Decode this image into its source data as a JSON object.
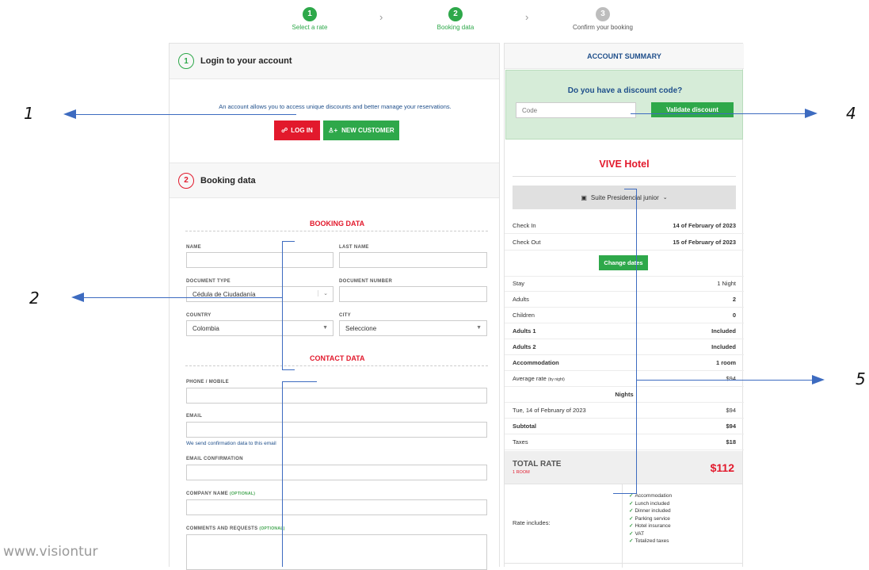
{
  "steps": [
    {
      "num": "1",
      "label": "Select a rate"
    },
    {
      "num": "2",
      "label": "Booking data"
    },
    {
      "num": "3",
      "label": "Confirm your booking"
    }
  ],
  "login": {
    "num": "1",
    "title": "Login to your account",
    "info": "An account allows you to access unique discounts and better manage your reservations.",
    "login_button": "LOG IN",
    "new_customer_button": "NEW CUSTOMER"
  },
  "booking": {
    "num": "2",
    "title": "Booking data",
    "booking_heading": "BOOKING DATA",
    "contact_heading": "CONTACT DATA",
    "name_label": "NAME",
    "lastname_label": "LAST NAME",
    "doctype_label": "DOCUMENT TYPE",
    "doctype_value": "Cédula de Ciudadanía",
    "docnum_label": "DOCUMENT NUMBER",
    "country_label": "COUNTRY",
    "country_value": "Colombia",
    "city_label": "CITY",
    "city_value": "Seleccione",
    "phone_label": "PHONE / MOBILE",
    "email_label": "EMAIL",
    "email_note": "We send confirmation data to this email",
    "email_confirm_label": "EMAIL CONFIRMATION",
    "company_label": "COMPANY NAME",
    "company_optional": "(OPTIONAL)",
    "comments_label": "COMMENTS AND REQUESTS",
    "comments_optional": "(OPTIONAL)"
  },
  "summary": {
    "title": "ACCOUNT SUMMARY",
    "discount_title": "Do you have a discount code?",
    "code_placeholder": "Code",
    "validate_button": "Validate discount",
    "hotel": "VIVE Hotel",
    "room": "Suite Presidencial junior",
    "checkin_label": "Check In",
    "checkin_value": "14 of February of 2023",
    "checkout_label": "Check Out",
    "checkout_value": "15 of February of 2023",
    "change_dates_button": "Change dates",
    "rows": [
      {
        "label": "Stay",
        "value": "1 Night",
        "bold": false
      },
      {
        "label": "Adults",
        "value": "2",
        "bold": false
      },
      {
        "label": "Children",
        "value": "0",
        "bold": false
      },
      {
        "label": "Adults 1",
        "value": "Included",
        "bold": true
      },
      {
        "label": "Adults 2",
        "value": "Included",
        "bold": true
      },
      {
        "label": "Accommodation",
        "value": "1 room",
        "bold": true
      }
    ],
    "avg_rate_label": "Average rate",
    "avg_rate_note": "(by night)",
    "avg_rate_value": "$94",
    "nights_heading": "Nights",
    "night_rows": [
      {
        "label": "Tue, 14 of February of 2023",
        "value": "$94",
        "bold": false
      },
      {
        "label": "Subtotal",
        "value": "$94",
        "bold": true
      },
      {
        "label": "Taxes",
        "value": "$18",
        "bold": true
      }
    ],
    "total_label": "TOTAL RATE",
    "total_rooms": "1 ROOM",
    "total_value": "$112",
    "includes_label": "Rate includes:",
    "includes": [
      "Accommodation",
      "Lunch included",
      "Dinner included",
      "Parking service",
      "Hotel insurance",
      "VAT",
      "Totalized taxes"
    ]
  },
  "callouts": [
    "1",
    "2",
    "4",
    "5"
  ],
  "watermark": "www.visiontur",
  "colors": {
    "green": "#2ea84a",
    "red": "#e2192c",
    "blue": "#1f4f8b",
    "arrow": "#3d6bc0"
  }
}
